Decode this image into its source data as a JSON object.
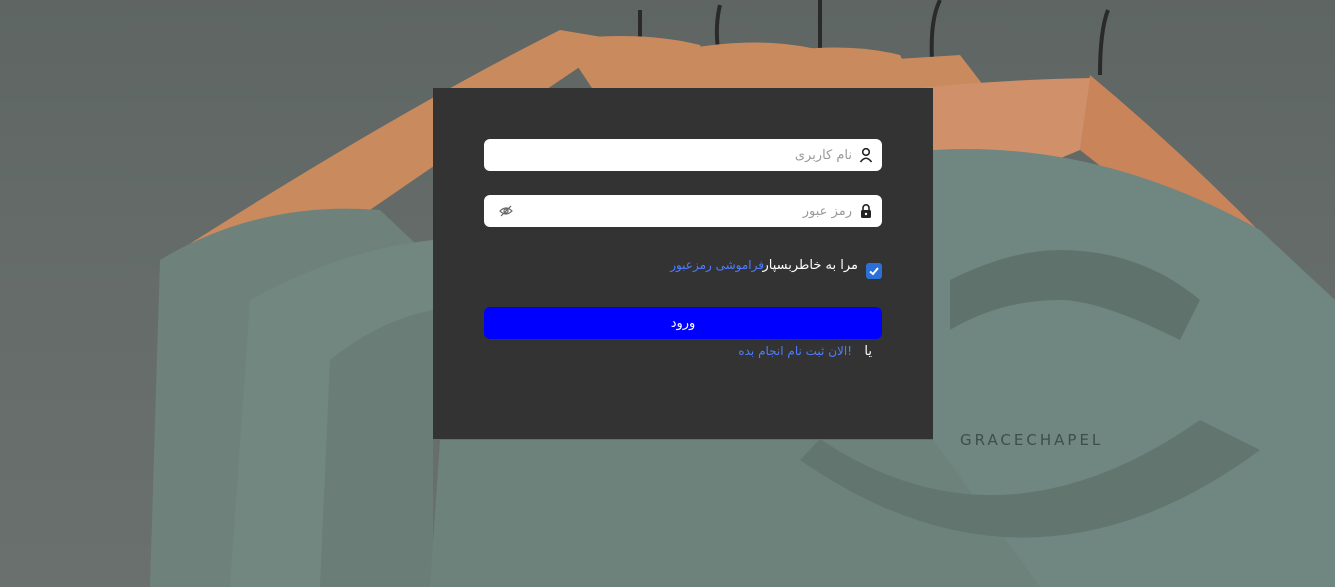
{
  "form": {
    "username_placeholder": "نام کاربری",
    "password_placeholder": "رمز عبور",
    "remember_label": "مرا به خاطربسپار",
    "remember_checked": true,
    "forgot_link": "فراموشی رمزعبور",
    "login_button": "ورود",
    "or_text": "یا",
    "signup_link": "الان ثبت نام انجام بده!"
  },
  "icons": {
    "username": "user-icon",
    "password": "lock-icon",
    "toggle": "eye-off-icon"
  },
  "colors": {
    "card": "#333333",
    "button": "#0000ff",
    "link": "#4f7cff",
    "checkbox": "#2b6fd8"
  }
}
